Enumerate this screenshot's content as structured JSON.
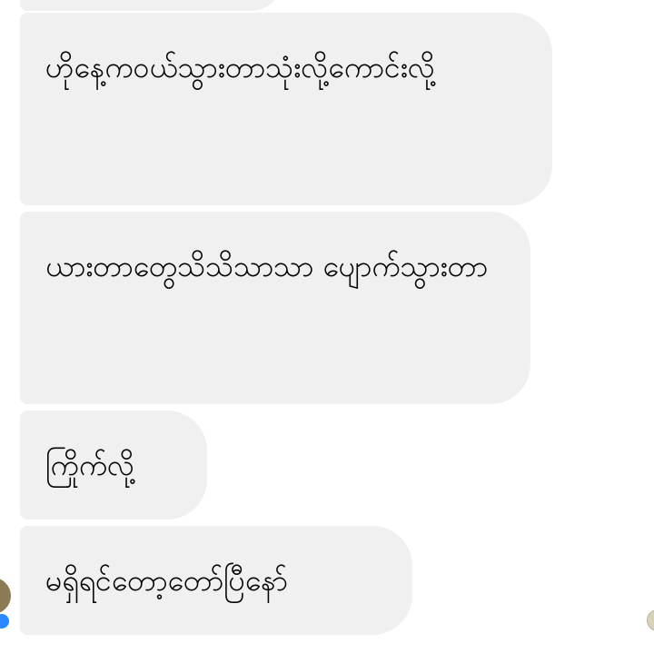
{
  "conversation": {
    "messages": [
      {
        "text": ""
      },
      {
        "text": "ဟိုနေ့ကဝယ်သွားတာသုံးလို့ကောင်းလို့"
      },
      {
        "text": "ယားတာတွေသိသိသာသာ ပျောက်သွားတာ"
      },
      {
        "text": "ကြိုက်လို့"
      },
      {
        "text": "မရှိရင်တော့တော်ပြီနော်"
      }
    ]
  },
  "icons": {
    "avatar": "contact-avatar",
    "avatar_badge": "messenger-badge-icon",
    "seen": "seen-avatar-icon"
  },
  "colors": {
    "bubble_background": "#f0f0f0",
    "text": "#050505",
    "badge": "#2d88ff"
  }
}
